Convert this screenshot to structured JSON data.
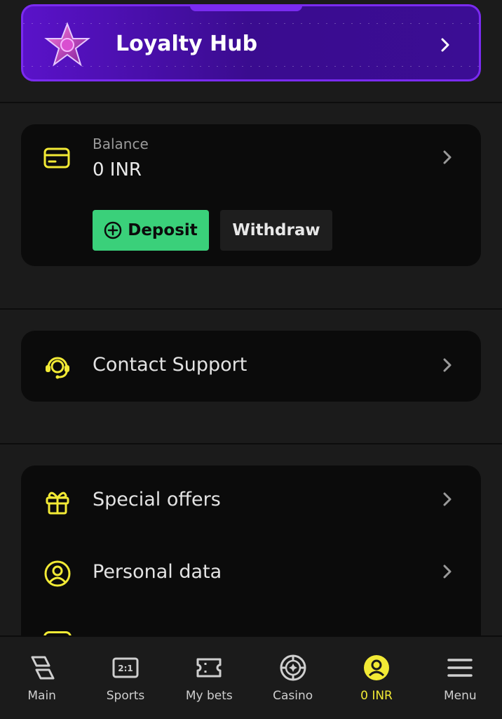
{
  "loyalty": {
    "title": "Loyalty Hub"
  },
  "balance": {
    "label": "Balance",
    "value": "0 INR",
    "deposit_label": "Deposit",
    "withdraw_label": "Withdraw"
  },
  "support": {
    "label": "Contact Support"
  },
  "menu_items": [
    {
      "label": "Special offers",
      "icon": "gift-icon"
    },
    {
      "label": "Personal data",
      "icon": "user-circle-icon"
    }
  ],
  "nav": [
    {
      "label": "Main",
      "icon": "main-icon",
      "active": false
    },
    {
      "label": "Sports",
      "icon": "sports-icon",
      "active": false
    },
    {
      "label": "My bets",
      "icon": "ticket-icon",
      "active": false
    },
    {
      "label": "Casino",
      "icon": "casino-chip-icon",
      "active": false
    },
    {
      "label": "0 INR",
      "icon": "account-icon",
      "active": true
    },
    {
      "label": "Menu",
      "icon": "hamburger-icon",
      "active": false
    }
  ],
  "colors": {
    "accent_yellow": "#f2ea35",
    "deposit_green": "#3ad07a",
    "loyalty_purple": "#5a12c9",
    "background": "#1b1b1b",
    "card": "#0b0b0b"
  }
}
